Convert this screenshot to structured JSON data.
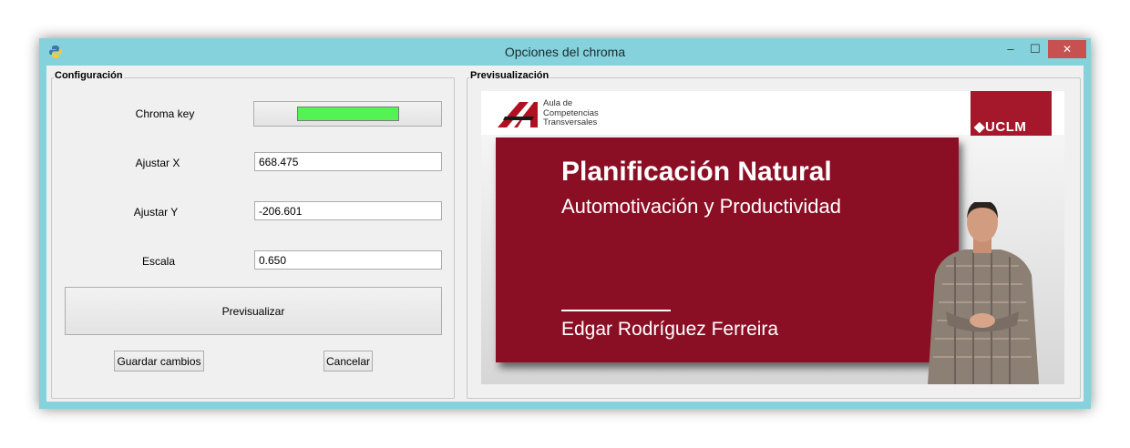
{
  "window": {
    "title": "Opciones del chroma",
    "controls": {
      "minimize": "–",
      "maximize": "☐",
      "close": "✕"
    }
  },
  "config": {
    "legend": "Configuración",
    "chroma_key_label": "Chroma key",
    "chroma_key_color": "#54f254",
    "adjust_x_label": "Ajustar X",
    "adjust_x_value": "668.475",
    "adjust_y_label": "Ajustar Y",
    "adjust_y_value": "-206.601",
    "scale_label": "Escala",
    "scale_value": "0.650",
    "preview_button": "Previsualizar",
    "save_button": "Guardar cambios",
    "cancel_button": "Cancelar"
  },
  "preview": {
    "legend": "Previsualización",
    "aula_text_1": "Aula de",
    "aula_text_2": "Competencias",
    "aula_text_3": "Transversales",
    "uclm_logo": "◆UCLM",
    "slide_title": "Planificación Natural",
    "slide_subtitle": "Automotivación y Productividad",
    "slide_author": "Edgar Rodríguez Ferreira",
    "slide_color": "#8b0f24"
  }
}
